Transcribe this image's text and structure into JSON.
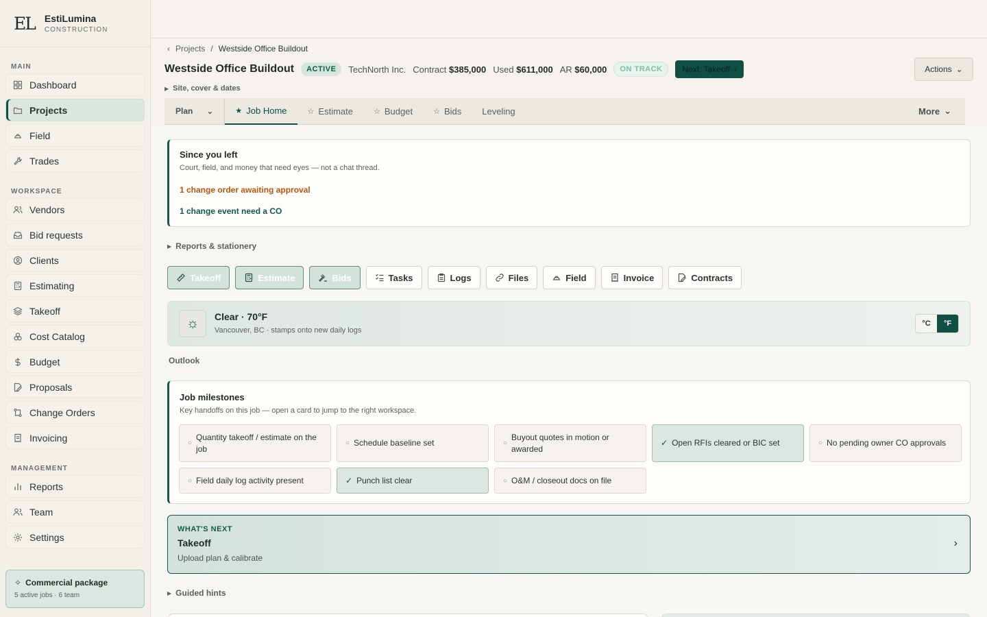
{
  "brand": {
    "logo": "EL",
    "name": "EstiLumina",
    "sub": "CONSTRUCTION"
  },
  "sidebar": {
    "main_heading": "MAIN",
    "main": [
      {
        "label": "Dashboard",
        "icon": "grid-icon"
      },
      {
        "label": "Projects",
        "icon": "folder-icon",
        "active": true
      },
      {
        "label": "Field",
        "icon": "hardhat-icon"
      },
      {
        "label": "Trades",
        "icon": "wrench-icon"
      }
    ],
    "workspace_heading": "WORKSPACE",
    "workspace": [
      {
        "label": "Vendors",
        "icon": "users-icon"
      },
      {
        "label": "Bid requests",
        "icon": "inbox-icon"
      },
      {
        "label": "Clients",
        "icon": "user-circle-icon"
      },
      {
        "label": "Estimating",
        "icon": "calculator-icon"
      },
      {
        "label": "Takeoff",
        "icon": "layers-icon"
      },
      {
        "label": "Cost Catalog",
        "icon": "boxes-icon"
      },
      {
        "label": "Budget",
        "icon": "dollar-icon"
      },
      {
        "label": "Proposals",
        "icon": "document-pen-icon"
      },
      {
        "label": "Change Orders",
        "icon": "git-compare-icon"
      },
      {
        "label": "Invoicing",
        "icon": "receipt-icon"
      }
    ],
    "management_heading": "MANAGEMENT",
    "management": [
      {
        "label": "Reports",
        "icon": "bar-chart-icon"
      },
      {
        "label": "Team",
        "icon": "users-icon"
      },
      {
        "label": "Settings",
        "icon": "gear-icon"
      }
    ],
    "package": {
      "title": "Commercial package",
      "sub": "5 active jobs · 6 team"
    }
  },
  "breadcrumb": {
    "parent": "Projects",
    "sep": "/",
    "current": "Westside Office Buildout"
  },
  "header": {
    "title": "Westside Office Buildout",
    "status": "ACTIVE",
    "client": "TechNorth Inc.",
    "contract_label": "Contract",
    "contract": "$385,000",
    "used_label": "Used",
    "used": "$611,000",
    "ar_label": "AR",
    "ar": "$60,000",
    "health": "ON TRACK",
    "next_button": "Next: Takeoff",
    "actions": "Actions",
    "site_toggle": "Site, cover & dates"
  },
  "tabs": {
    "plan": "Plan",
    "items": [
      {
        "label": "Job Home",
        "star": "★",
        "active": true
      },
      {
        "label": "Estimate",
        "star": "☆"
      },
      {
        "label": "Budget",
        "star": "☆"
      },
      {
        "label": "Bids",
        "star": "☆"
      },
      {
        "label": "Leveling",
        "star": ""
      }
    ],
    "more": "More"
  },
  "since": {
    "title": "Since you left",
    "sub": "Court, field, and money that need eyes — not a chat thread.",
    "alert_co": "1 change order awaiting approval",
    "alert_event": "1 change event need a CO"
  },
  "reports_toggle": "Reports & stationery",
  "quick_actions": [
    {
      "label": "Takeoff",
      "icon": "ruler-icon",
      "tinted": true
    },
    {
      "label": "Estimate",
      "icon": "calculator-icon",
      "tinted": true
    },
    {
      "label": "Bids",
      "icon": "gavel-icon",
      "tinted": true
    },
    {
      "label": "Tasks",
      "icon": "list-check-icon"
    },
    {
      "label": "Logs",
      "icon": "clipboard-icon"
    },
    {
      "label": "Files",
      "icon": "link-icon"
    },
    {
      "label": "Field",
      "icon": "hardhat-icon"
    },
    {
      "label": "Invoice",
      "icon": "receipt-icon"
    },
    {
      "label": "Contracts",
      "icon": "document-pen-icon"
    }
  ],
  "weather": {
    "title": "Clear · 70°F",
    "sub": "Vancouver, BC · stamps onto new daily logs",
    "unit_c": "°C",
    "unit_f": "°F",
    "selected_unit": "°F"
  },
  "outlook": "Outlook",
  "milestones": {
    "title": "Job milestones",
    "sub": "Key handoffs on this job — open a card to jump to the right workspace.",
    "items": [
      {
        "label": "Quantity takeoff / estimate on the job",
        "done": false
      },
      {
        "label": "Schedule baseline set",
        "done": false
      },
      {
        "label": "Buyout quotes in motion or awarded",
        "done": false
      },
      {
        "label": "Open RFIs cleared or BIC set",
        "done": true
      },
      {
        "label": "No pending owner CO approvals",
        "done": false
      },
      {
        "label": "Field daily log activity present",
        "done": false
      },
      {
        "label": "Punch list clear",
        "done": true
      },
      {
        "label": "O&M / closeout docs on file",
        "done": false
      }
    ]
  },
  "whats_next": {
    "kicker": "WHAT'S NEXT",
    "title": "Takeoff",
    "sub": "Upload plan & calibrate"
  },
  "hints_toggle": "Guided hints"
}
